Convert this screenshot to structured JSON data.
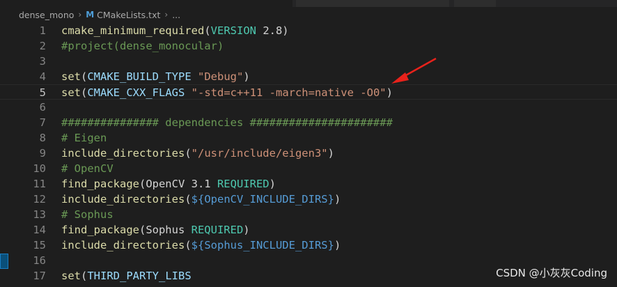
{
  "breadcrumb": {
    "folder": "dense_mono",
    "file_icon": "M",
    "file": "CMakeLists.txt",
    "tail": "..."
  },
  "lines": [
    {
      "n": "1",
      "parts": [
        [
          "fn",
          "cmake_minimum_required"
        ],
        [
          "plain",
          "("
        ],
        [
          "kw",
          "VERSION"
        ],
        [
          "plain",
          " 2.8)"
        ]
      ]
    },
    {
      "n": "2",
      "parts": [
        [
          "cmt",
          "#project(dense_monocular)"
        ]
      ]
    },
    {
      "n": "3",
      "parts": []
    },
    {
      "n": "4",
      "parts": [
        [
          "fn",
          "set"
        ],
        [
          "plain",
          "("
        ],
        [
          "var",
          "CMAKE_BUILD_TYPE"
        ],
        [
          "plain",
          " "
        ],
        [
          "str",
          "\"Debug\""
        ],
        [
          "plain",
          ")"
        ]
      ]
    },
    {
      "n": "5",
      "parts": [
        [
          "fn",
          "set"
        ],
        [
          "plain",
          "("
        ],
        [
          "var",
          "CMAKE_CXX_FLAGS"
        ],
        [
          "plain",
          " "
        ],
        [
          "str",
          "\"-std=c++11 -march=native -O0\""
        ],
        [
          "plain",
          ")"
        ]
      ]
    },
    {
      "n": "6",
      "parts": []
    },
    {
      "n": "7",
      "parts": [
        [
          "cmt",
          "############### dependencies ######################"
        ]
      ]
    },
    {
      "n": "8",
      "parts": [
        [
          "cmt",
          "# Eigen"
        ]
      ]
    },
    {
      "n": "9",
      "parts": [
        [
          "fn",
          "include_directories"
        ],
        [
          "plain",
          "("
        ],
        [
          "str",
          "\"/usr/include/eigen3\""
        ],
        [
          "plain",
          ")"
        ]
      ]
    },
    {
      "n": "10",
      "parts": [
        [
          "cmt",
          "# OpenCV"
        ]
      ]
    },
    {
      "n": "11",
      "parts": [
        [
          "fn",
          "find_package"
        ],
        [
          "plain",
          "(OpenCV 3.1 "
        ],
        [
          "kw",
          "REQUIRED"
        ],
        [
          "plain",
          ")"
        ]
      ]
    },
    {
      "n": "12",
      "parts": [
        [
          "fn",
          "include_directories"
        ],
        [
          "plain",
          "("
        ],
        [
          "dv",
          "${OpenCV_INCLUDE_DIRS}"
        ],
        [
          "plain",
          ")"
        ]
      ]
    },
    {
      "n": "13",
      "parts": [
        [
          "cmt",
          "# Sophus"
        ]
      ]
    },
    {
      "n": "14",
      "parts": [
        [
          "fn",
          "find_package"
        ],
        [
          "plain",
          "(Sophus "
        ],
        [
          "kw",
          "REQUIRED"
        ],
        [
          "plain",
          ")"
        ]
      ]
    },
    {
      "n": "15",
      "parts": [
        [
          "fn",
          "include_directories"
        ],
        [
          "plain",
          "("
        ],
        [
          "dv",
          "${Sophus_INCLUDE_DIRS}"
        ],
        [
          "plain",
          ")"
        ]
      ]
    },
    {
      "n": "16",
      "parts": []
    },
    {
      "n": "17",
      "parts": [
        [
          "fn",
          "set"
        ],
        [
          "plain",
          "("
        ],
        [
          "var",
          "THIRD_PARTY_LIBS"
        ]
      ]
    }
  ],
  "current_line": "5",
  "annotation": {
    "arrow_color": "#e8221b"
  },
  "watermark": "CSDN @小灰灰Coding",
  "colors": {
    "background": "#1e1e1e",
    "function": "#dcdcaa",
    "string": "#ce9178",
    "keyword": "#4ec9b0",
    "comment": "#6a9955",
    "variable": "#9cdcfe",
    "deref": "#569cd6"
  }
}
